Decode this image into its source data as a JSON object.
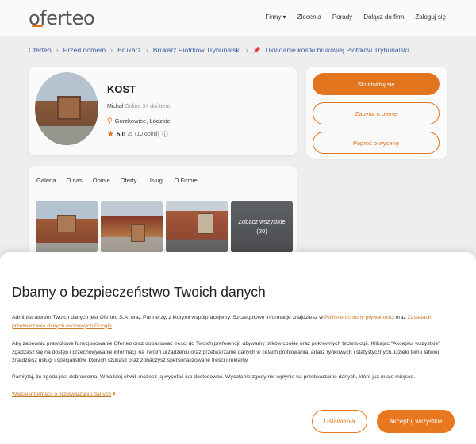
{
  "header": {
    "logo": "oferteo",
    "nav": [
      "Firmy ▾",
      "Zlecenia",
      "Porady",
      "Dołącz do firm",
      "Zaloguj się"
    ]
  },
  "breadcrumb": {
    "items": [
      "Oferteo",
      "Przed domem",
      "Brukarz",
      "Brukarz Piotrków Trybunalski"
    ],
    "current": "Układanie kostki brukowej Piotrków Trybunalski"
  },
  "profile": {
    "name": "KOST",
    "owner": "Michał",
    "online_status": "Online 3+ dni temu",
    "location": "Gorzkowice, Łódzkie",
    "rating_value": "5.0",
    "rating_scale": "/5",
    "rating_count": "(10 opinii)"
  },
  "actions": {
    "contact": "Skontaktuj się",
    "ask_offer": "Zapytaj o ofertę",
    "ask_quote": "Poproś o wycenę"
  },
  "tabs": [
    "Galeria",
    "O nas",
    "Opinie",
    "Oferty",
    "Usługi",
    "O Firmie"
  ],
  "gallery": {
    "see_all_label": "Zobacz wszystkie",
    "see_all_count": "(20)"
  },
  "consent": {
    "title": "Dbamy o bezpieczeństwo Twoich danych",
    "p1_text": "Administratorem Twoich danych jest Oferteo S.A. oraz Partnerzy, z którymi współpracujemy. Szczegółowe informacje znajdziesz w ",
    "p1_link1": "Polityce ochrony prywatności",
    "p1_mid": " oraz ",
    "p1_link2": "Zasadach przetwarzania danych osobowych Google",
    "p1_end": ".",
    "p2": "Aby zapewnić prawidłowe funkcjonowanie Oferteo oraz dopasować treści do Twoich preferencji, używamy plików cookie oraz pokrewnych technologii. Klikając \"Akceptuj wszystkie\" zgadzasz się na dostęp i przechowywanie informacji na Twoim urządzeniu oraz przetwarzanie danych w celach profilowania, analiz rynkowych i statystycznych. Dzięki temu łatwiej znajdziesz usługi i specjalistów, których szukasz oraz zobaczysz spersonalizowane treści i reklamy.",
    "p3": "Pamiętaj, że zgoda jest dobrowolna. W każdej chwili możesz ją wycofać lub dostosować. Wycofanie zgody nie wpłynie na przetwarzanie danych, które już miało miejsce.",
    "more_link": "Więcej informacji o przetwarzaniu danych",
    "settings_button": "Ustawienia",
    "accept_button": "Akceptuj wszystkie"
  },
  "colors": {
    "accent": "#e8771f",
    "link": "#3b5fa8"
  }
}
